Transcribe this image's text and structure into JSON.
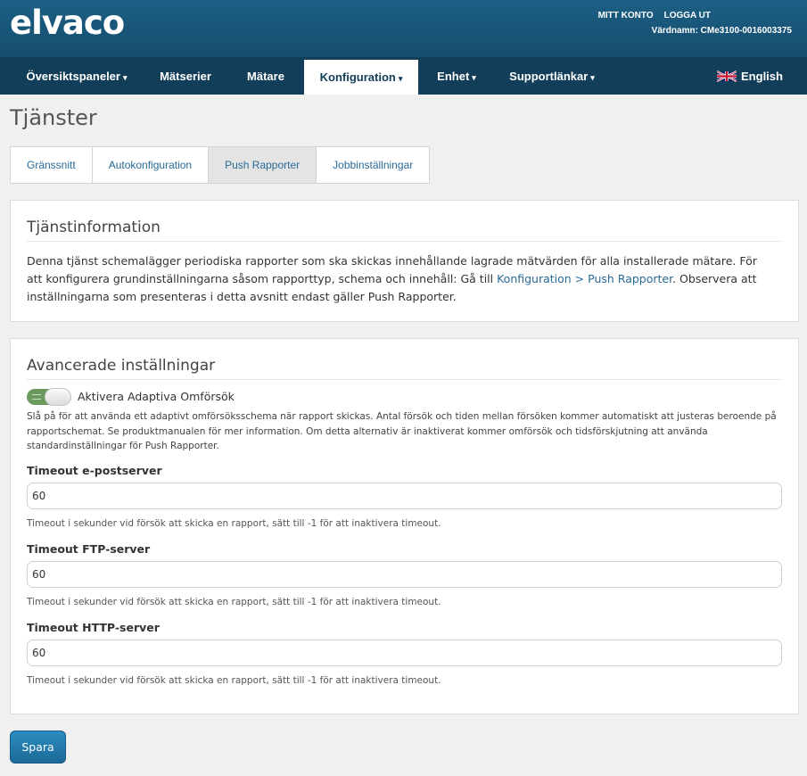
{
  "header": {
    "logo": "elvaco",
    "account_link": "MITT KONTO",
    "logout_link": "LOGGA UT",
    "host_label": "Värdnamn: CMe3100-0016003375"
  },
  "nav": {
    "items": [
      {
        "label": "Översiktspaneler",
        "caret": "▾"
      },
      {
        "label": "Mätserier"
      },
      {
        "label": "Mätare"
      },
      {
        "label": "Konfiguration",
        "caret": "▾"
      },
      {
        "label": "Enhet",
        "caret": "▾"
      },
      {
        "label": "Supportlänkar",
        "caret": "▾"
      }
    ],
    "language": "English"
  },
  "page": {
    "title": "Tjänster",
    "tabs": [
      "Gränssnitt",
      "Autokonfiguration",
      "Push Rapporter",
      "Jobbinställningar"
    ]
  },
  "info_panel": {
    "heading": "Tjänstinformation",
    "text_before": "Denna tjänst schemalägger periodiska rapporter som ska skickas innehållande lagrade mätvärden för alla installerade mätare. För att konfigurera grundinställningarna såsom rapporttyp, schema och innehåll: Gå till ",
    "link_text": "Konfiguration > Push Rapporter",
    "text_after": ". Observera att inställningarna som presenteras i detta avsnitt endast gäller Push Rapporter."
  },
  "advanced_panel": {
    "heading": "Avancerade inställningar",
    "toggle_label": "Aktivera Adaptiva Omförsök",
    "toggle_on": true,
    "toggle_help": "Slå på för att använda ett adaptivt omförsöksschema när rapport skickas. Antal försök och tiden mellan försöken kommer automatiskt att justeras beroende på rapportschemat. Se produktmanualen för mer information. Om detta alternativ är inaktiverat kommer omförsök och tidsförskjutning att använda standardinställningar för Push Rapporter.",
    "fields": [
      {
        "label": "Timeout e-postserver",
        "value": "60",
        "help": "Timeout i sekunder vid försök att skicka en rapport, sätt till -1 för att inaktivera timeout."
      },
      {
        "label": "Timeout FTP-server",
        "value": "60",
        "help": "Timeout i sekunder vid försök att skicka en rapport, sätt till -1 för att inaktivera timeout."
      },
      {
        "label": "Timeout HTTP-server",
        "value": "60",
        "help": "Timeout i sekunder vid försök att skicka en rapport, sätt till -1 för att inaktivera timeout."
      }
    ]
  },
  "save_label": "Spara",
  "colors": {
    "header": "#1c5f84",
    "navbar": "#123e59",
    "link": "#2a6a95",
    "button": "#2b8cc0"
  }
}
